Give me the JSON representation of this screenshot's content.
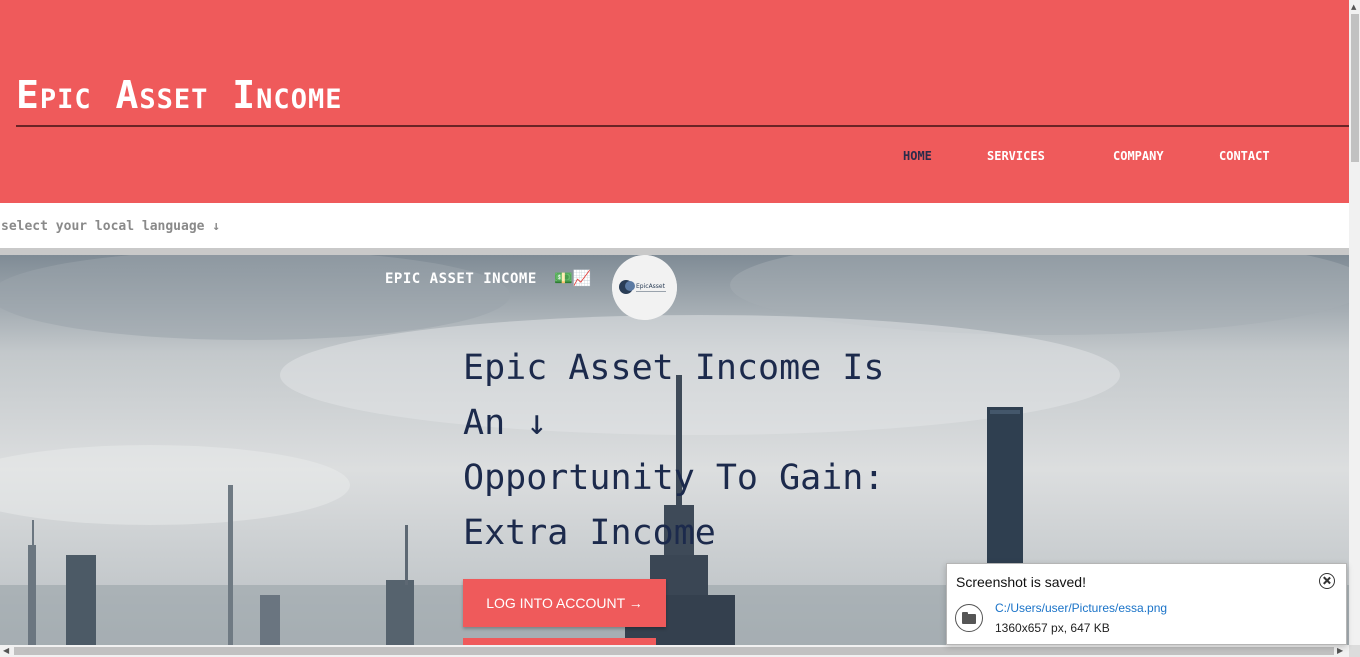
{
  "header": {
    "site_title": "Epic Asset Income",
    "nav": [
      {
        "label": "HOME",
        "active": true
      },
      {
        "label": "SERVICES",
        "active": false
      },
      {
        "label": "COMPANY",
        "active": false
      },
      {
        "label": "CONTACT",
        "active": false
      }
    ]
  },
  "language_bar": {
    "label": "select your local language ↓"
  },
  "hero": {
    "brand_text": "EPIC ASSET INCOME",
    "brand_icons": "💵📈",
    "logo_text": "EpicAsset",
    "headline_lines": [
      "Epic Asset Income Is",
      "An ↓",
      "Opportunity To Gain:",
      "Extra Income"
    ],
    "login_button": "LOG INTO ACCOUNT →"
  },
  "toast": {
    "title": "Screenshot is saved!",
    "path": "C:/Users/user/Pictures/essa.png",
    "meta": "1360x657 px, 647 KB"
  },
  "colors": {
    "header_bg": "#ef5a5b",
    "headline": "#1c2a4c",
    "button_bg": "#ef5a5b"
  }
}
